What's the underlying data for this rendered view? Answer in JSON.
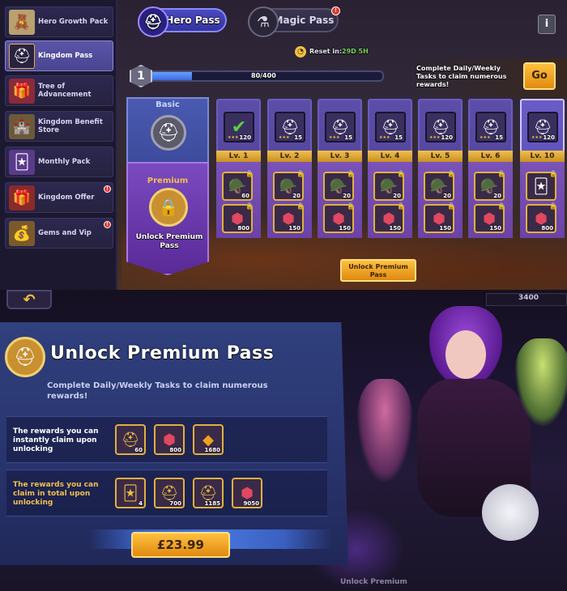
{
  "sidebar": {
    "items": [
      {
        "label": "Hero Growth Pack",
        "icon": "hero-icon",
        "badge": ""
      },
      {
        "label": "Kingdom Pass",
        "icon": "helmet-icon",
        "badge": ""
      },
      {
        "label": "Tree of Advancement",
        "icon": "tree-icon",
        "badge": ""
      },
      {
        "label": "Kingdom Benefit Store",
        "icon": "store-icon",
        "badge": ""
      },
      {
        "label": "Monthly Pack",
        "icon": "card-icon",
        "badge": ""
      },
      {
        "label": "Kingdom Offer",
        "icon": "gift-icon",
        "badge": "!"
      },
      {
        "label": "Gems and Vip",
        "icon": "chest-icon",
        "badge": "!"
      }
    ]
  },
  "tabs": {
    "hero_pass": "Hero Pass",
    "magic_pass": "Magic Pass",
    "magic_badge": "!"
  },
  "info_button": "i",
  "reset": {
    "label": "Reset in:",
    "value": "29D 5H"
  },
  "progress": {
    "level": "1",
    "text": "80/400",
    "fraction": 0.2
  },
  "go_prompt": "Complete Daily/Weekly Tasks to claim numerous rewards!",
  "go_button": "Go",
  "basic_label": "Basic",
  "premium_label": "Premium",
  "unlock_premium_small": "Unlock Premium Pass",
  "unlock_premium_button": "Unlock Premium Pass",
  "levels": [
    {
      "lv": "Lv. 1",
      "top": "120",
      "mid": "60",
      "bot": "800"
    },
    {
      "lv": "Lv. 2",
      "top": "15",
      "mid": "20",
      "bot": "150"
    },
    {
      "lv": "Lv. 3",
      "top": "15",
      "mid": "20",
      "bot": "150"
    },
    {
      "lv": "Lv. 4",
      "top": "15",
      "mid": "20",
      "bot": "150"
    },
    {
      "lv": "Lv. 5",
      "top": "120",
      "mid": "20",
      "bot": "150"
    },
    {
      "lv": "Lv. 6",
      "top": "15",
      "mid": "20",
      "bot": "150"
    },
    {
      "lv": "Lv. 10",
      "top": "120",
      "mid": "",
      "bot": "800"
    }
  ],
  "dialog": {
    "back": "↶",
    "score": "3400",
    "title": "Unlock Premium Pass",
    "subtitle": "Complete Daily/Weekly Tasks to claim numerous rewards!",
    "row1_label": "The rewards you can instantly claim upon unlocking",
    "row1_items": [
      {
        "icon": "helmet-token-icon",
        "value": "60"
      },
      {
        "icon": "ruby-icon",
        "value": "800"
      },
      {
        "icon": "gem-icon",
        "value": "1680"
      }
    ],
    "row2_label": "The rewards you can claim in total upon unlocking",
    "row2_items": [
      {
        "icon": "card-pack-icon",
        "value": "4"
      },
      {
        "icon": "helmet-token-icon",
        "value": "700"
      },
      {
        "icon": "hero-shard-icon",
        "value": "1185"
      },
      {
        "icon": "ruby-icon",
        "value": "9050"
      }
    ],
    "price": "£23.99",
    "footer": "Unlock Premium"
  }
}
